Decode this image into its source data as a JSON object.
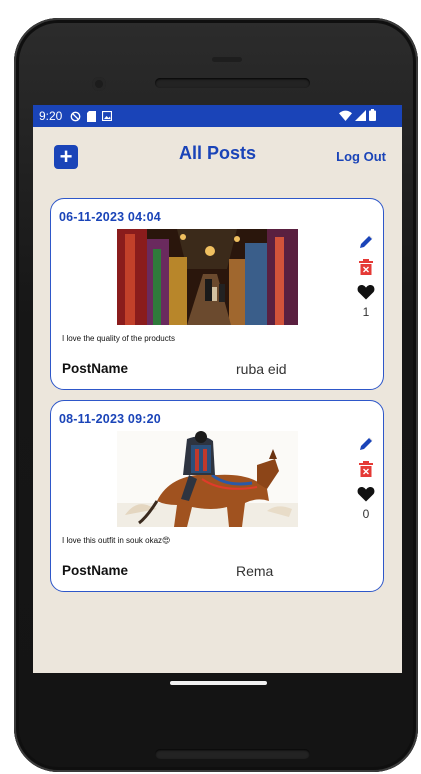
{
  "statusbar": {
    "time": "9:20"
  },
  "appbar": {
    "add_label": "+",
    "title": "All Posts",
    "logout_label": "Log Out"
  },
  "posts": [
    {
      "date": "06-11-2023 04:04",
      "caption": "I love the quality of the products",
      "name_label": "PostName",
      "name_value": "ruba eid",
      "likes": "1"
    },
    {
      "date": "08-11-2023 09:20",
      "caption": "I love this outfit in souk okaz😍",
      "name_label": "PostName",
      "name_value": "Rema",
      "likes": "0"
    }
  ],
  "colors": {
    "accent": "#1a44b8",
    "delete": "#e53935",
    "background": "#ece6dc"
  }
}
